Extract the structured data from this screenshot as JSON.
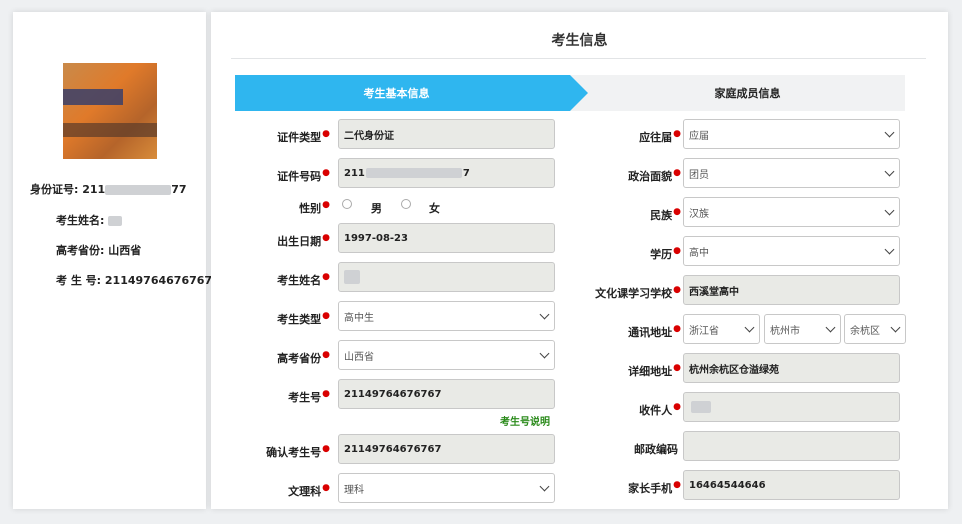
{
  "profile": {
    "id_label": "身份证号:",
    "id_prefix": "211",
    "id_suffix": "77",
    "name_label": "考生姓名:",
    "province_label": "高考省份:",
    "province_value": "山西省",
    "exam_no_label": "考 生 号:",
    "exam_no_value": "21149764676767"
  },
  "header": {
    "title": "考生信息"
  },
  "tabs": [
    {
      "label": "考生基本信息",
      "active": true
    },
    {
      "label": "家庭成员信息",
      "active": false
    }
  ],
  "left_form": {
    "id_type": {
      "label": "证件类型",
      "value": "二代身份证"
    },
    "id_number": {
      "label": "证件号码",
      "value_prefix": "211",
      "value_suffix": "7"
    },
    "gender": {
      "label": "性别",
      "options": [
        "男",
        "女"
      ]
    },
    "birth_date": {
      "label": "出生日期",
      "value": "1997-08-23"
    },
    "name": {
      "label": "考生姓名"
    },
    "student_type": {
      "label": "考生类型",
      "value": "高中生"
    },
    "province": {
      "label": "高考省份",
      "value": "山西省"
    },
    "exam_no": {
      "label": "考生号",
      "value": "21149764676767",
      "help_link": "考生号说明"
    },
    "confirm_exam_no": {
      "label": "确认考生号",
      "value": "21149764676767"
    },
    "subject": {
      "label": "文理科",
      "value": "理科"
    }
  },
  "right_form": {
    "grad_status": {
      "label": "应往届",
      "value": "应届"
    },
    "political": {
      "label": "政治面貌",
      "value": "团员"
    },
    "ethnicity": {
      "label": "民族",
      "value": "汉族"
    },
    "education": {
      "label": "学历",
      "value": "高中"
    },
    "school": {
      "label": "文化课学习学校",
      "value": "西溪堂高中"
    },
    "address": {
      "label": "通讯地址",
      "province": "浙江省",
      "city": "杭州市",
      "district": "余杭区"
    },
    "detail_address": {
      "label": "详细地址",
      "value": "杭州余杭区仓溢绿苑"
    },
    "recipient": {
      "label": "收件人"
    },
    "postcode": {
      "label": "邮政编码",
      "value": ""
    },
    "parent_phone": {
      "label": "家长手机",
      "value": "16464544646"
    }
  },
  "colors": {
    "accent": "#2fb6ef",
    "required": "#d90000",
    "link": "#2a8a1a"
  }
}
